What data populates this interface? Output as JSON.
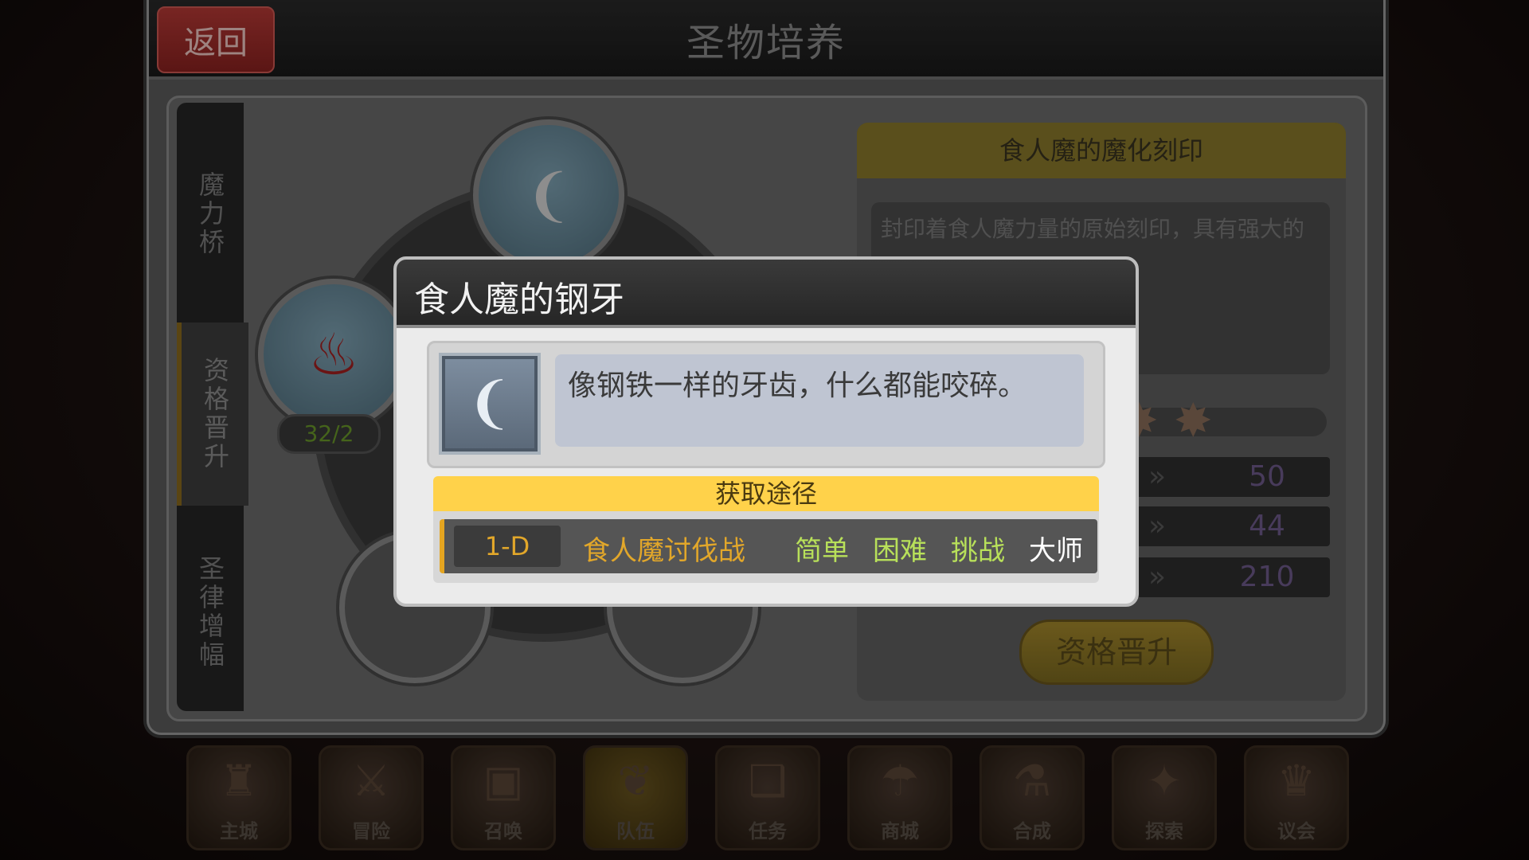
{
  "header": {
    "title": "圣物培养",
    "back_label": "返回"
  },
  "side_tabs": [
    {
      "label": "魔力桥",
      "active": false
    },
    {
      "label": "资格晋升",
      "active": true
    },
    {
      "label": "圣律增幅",
      "active": false
    }
  ],
  "relic_slots": {
    "top_icon": "fang-icon",
    "left_icon": "red-shell-icon",
    "left_count": "32/2"
  },
  "info_panel": {
    "title": "食人魔的魔化刻印",
    "description": "封印着食人魔力量的原始刻印，具有强大的",
    "stats": [
      "50",
      "44",
      "210"
    ],
    "upgrade_label": "资格晋升"
  },
  "bottom_nav": [
    {
      "label": "主城",
      "icon": "castle-icon"
    },
    {
      "label": "冒险",
      "icon": "swords-icon"
    },
    {
      "label": "召唤",
      "icon": "card-icon"
    },
    {
      "label": "队伍",
      "icon": "wings-icon",
      "active": true
    },
    {
      "label": "任务",
      "icon": "book-icon"
    },
    {
      "label": "商城",
      "icon": "shop-icon"
    },
    {
      "label": "合成",
      "icon": "flask-icon"
    },
    {
      "label": "探索",
      "icon": "compass-icon"
    },
    {
      "label": "议会",
      "icon": "council-icon"
    }
  ],
  "modal": {
    "title": "食人魔的钢牙",
    "item_icon": "fang-icon",
    "item_description": "像钢铁一样的牙齿，什么都能咬碎。",
    "source_title": "获取途径",
    "source": {
      "stage_code": "1-D",
      "stage_name": "食人魔讨伐战",
      "difficulties": [
        "简单",
        "困难",
        "挑战",
        "大师"
      ]
    }
  },
  "colors": {
    "modal_source_bar": "#ffd24a",
    "stage_text": "#e2a72a",
    "difficulty_green": "#b8e05a",
    "difficulty_master": "#ffffff"
  }
}
